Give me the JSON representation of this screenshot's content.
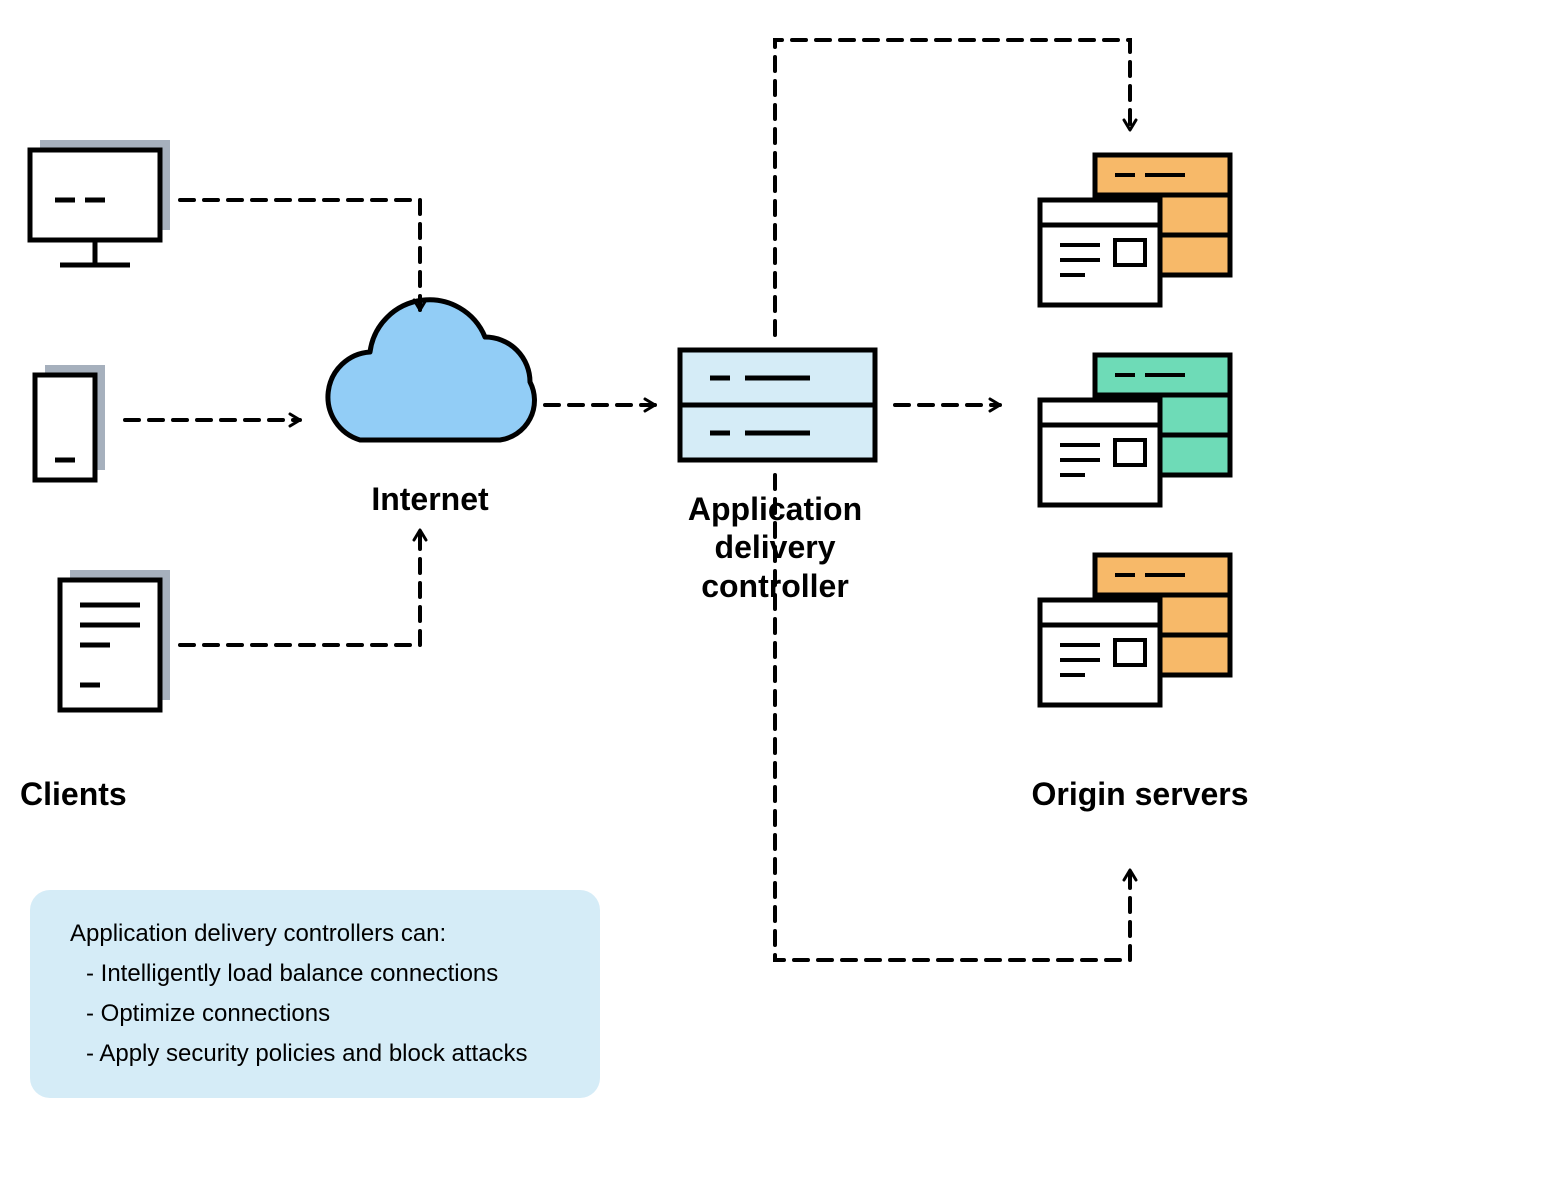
{
  "labels": {
    "internet": "Internet",
    "adc_line1": "Application",
    "adc_line2": "delivery",
    "adc_line3": "controller",
    "clients": "Clients",
    "origin": "Origin servers"
  },
  "callout": {
    "heading": "Application delivery controllers can:",
    "items": [
      "- Intelligently load balance connections",
      "- Optimize connections",
      "- Apply security policies and block attacks"
    ]
  },
  "colors": {
    "client_fill": "#a6b0bd",
    "cloud_fill": "#92cdf6",
    "adc_fill": "#d5ecf7",
    "server_orange": "#f7b969",
    "server_teal": "#6edbb7",
    "callout_bg": "#d5ecf7",
    "stroke": "#000000"
  }
}
